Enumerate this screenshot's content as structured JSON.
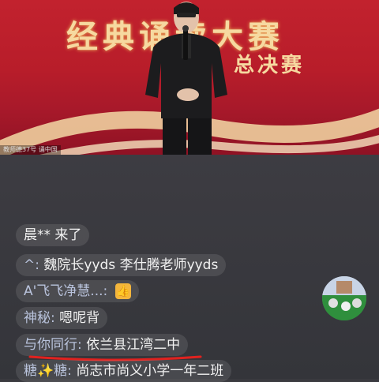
{
  "video": {
    "banner_title": "经典诵读大赛",
    "banner_subtitle": "总决赛",
    "overlay_label": "教师德37号 诵中国"
  },
  "chat": {
    "messages": [
      {
        "name": "晨** 来了",
        "text": ""
      },
      {
        "name": "^:",
        "text": "魏院长yyds 李仕腾老师yyds"
      },
      {
        "name": "A'飞飞净慧...:",
        "text": "👍"
      },
      {
        "name": "神秘:",
        "text": "嗯呢背"
      },
      {
        "name": "与你同行:",
        "text": "依兰县江湾二中"
      },
      {
        "name": "糖✨糖:",
        "text": "尚志市尚义小学一年二班"
      }
    ]
  },
  "colors": {
    "stage_red": "#c2222e",
    "gold": "#f6d9a0",
    "chat_bg": "#3a3a3f",
    "underline_red": "#e0221f"
  }
}
